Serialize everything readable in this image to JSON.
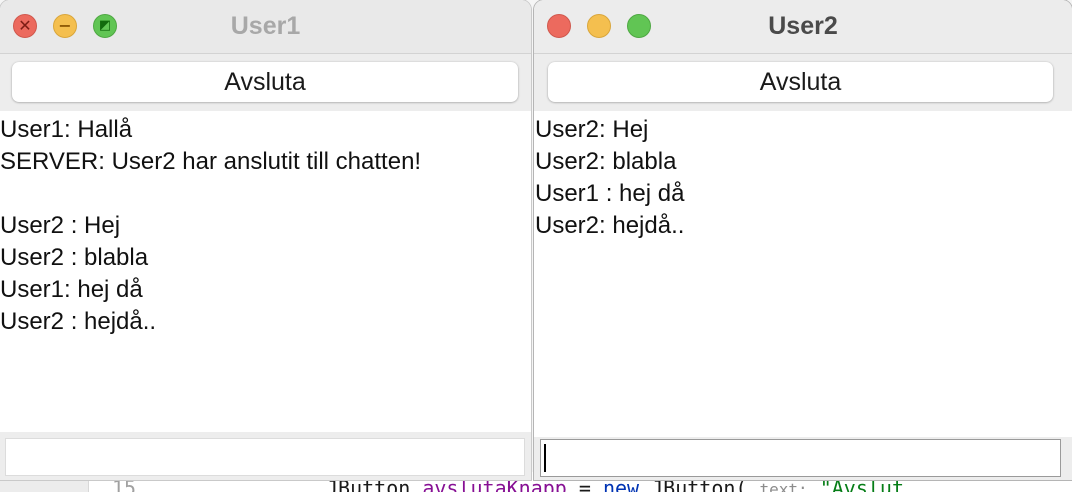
{
  "editor": {
    "line_number": "15",
    "code_prefix": "JButton ",
    "code_field": "avslutaKnapp",
    "code_eq": " = ",
    "code_new": "new",
    "code_ctor": " JButton( ",
    "code_hint": "text:",
    "code_string": " \"Avslut"
  },
  "windows": [
    {
      "title": "User1",
      "state": "inactive",
      "quit_button_label": "Avsluta",
      "messages": [
        "User1: Hallå",
        "SERVER: User2 har anslutit till chatten!",
        "",
        "User2 : Hej",
        "User2 : blabla",
        "User1: hej då",
        "User2 : hejdå.."
      ],
      "input_value": ""
    },
    {
      "title": "User2",
      "state": "active",
      "quit_button_label": "Avsluta",
      "messages": [
        "User2: Hej",
        "User2: blabla",
        "User1 : hej då",
        "User2: hejdå.."
      ],
      "input_value": ""
    }
  ],
  "colors": {
    "close": "#ec6a5e",
    "minimize": "#f4bf4f",
    "maximize": "#61c554"
  }
}
